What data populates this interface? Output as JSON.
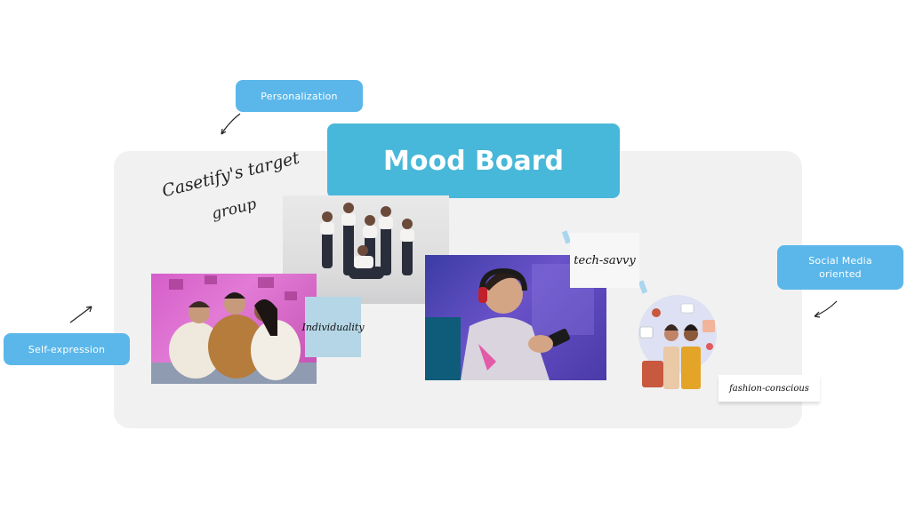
{
  "title": "Mood Board",
  "handwritten_heading": {
    "line1": "Casetify's target",
    "line2": "group"
  },
  "tags": {
    "personalization": "Personalization",
    "self_expression": "Self-expression",
    "social_media": "Social Media oriented"
  },
  "notes": {
    "individuality": "Individuality",
    "tech_savvy": "tech-savvy",
    "fashion_conscious": "fashion-conscious"
  },
  "colors": {
    "tag_blue": "#5bb7ea",
    "title_blue": "#47b8d9",
    "board_gray": "#f1f1f2",
    "sticky_blue": "#b5d6e6"
  }
}
